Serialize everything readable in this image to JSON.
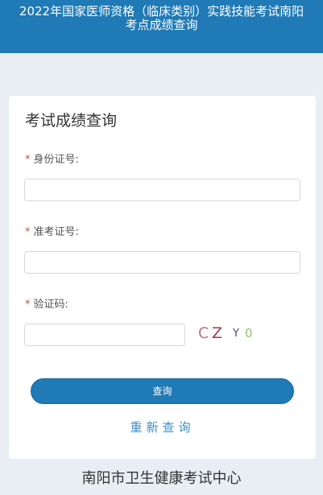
{
  "header": {
    "title_line1": "2022年国家医师资格（临床类别）实践技能考试南阳",
    "title_line2": "考点成绩查询"
  },
  "form": {
    "title": "考试成绩查询",
    "required_mark": "*",
    "id_label": "身份证号:",
    "id_value": "",
    "ticket_label": "准考证号:",
    "ticket_value": "",
    "captcha_label": "验证码:",
    "captcha_value": "",
    "captcha": {
      "chars": [
        "C",
        "Z",
        "Y",
        "0"
      ],
      "colors": [
        "#c2708a",
        "#a03a4a",
        "#4a4a7a",
        "#8fc46a"
      ]
    },
    "query_button": "查询",
    "reset_link": "重新查询"
  },
  "footer": {
    "text": "南阳市卫生健康考试中心"
  },
  "colors": {
    "header_bg": "#1f7ab6",
    "button_bg": "#1f7ab6",
    "page_bg": "#e8eef4",
    "required": "#e0443a",
    "link": "#3a8cc6"
  }
}
